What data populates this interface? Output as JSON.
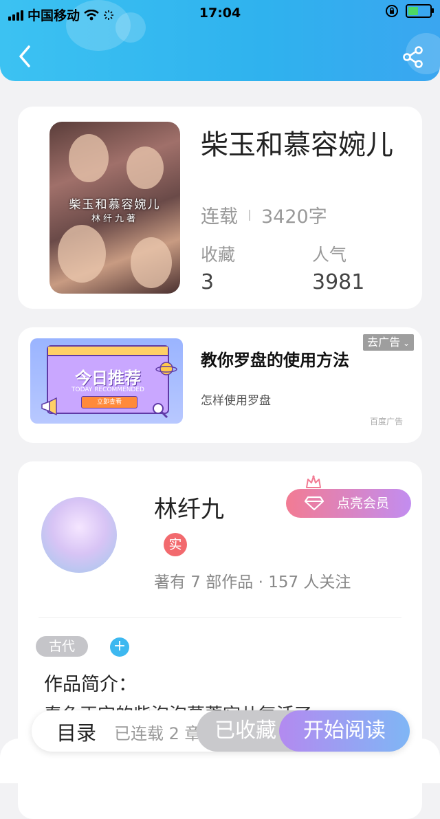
{
  "status_bar": {
    "carrier": "中国移动",
    "time": "17:04"
  },
  "book": {
    "title": "柴玉和慕容婉儿",
    "cover_title": "柴玉和慕容婉儿",
    "cover_author": "林纤九著",
    "status": "连载",
    "word_count": "3420字",
    "favorites_label": "收藏",
    "favorites_value": "3",
    "popularity_label": "人气",
    "popularity_value": "3981"
  },
  "ad": {
    "title": "教你罗盘的使用方法",
    "description": "怎样使用罗盘",
    "source": "百度广告",
    "tag": "去广告",
    "image_title": "今日推荐",
    "image_subtitle": "TODAY RECOMMENDED",
    "image_button": "立即查看"
  },
  "author": {
    "name": "林纤九",
    "vip_button": "点亮会员",
    "verified": "实",
    "works_info": "著有 7 部作品 · 157 人关注",
    "genre_tag": "古代",
    "add_tag": "+",
    "intro_label": "作品简介：",
    "intro_text": "春色正完的柴泡泡慕蓉宛儿复活了"
  },
  "bottom_bar": {
    "toc": "目录",
    "chapters": "已连载 2 章",
    "favorited": "已收藏",
    "start_reading": "开始阅读"
  },
  "colors": {
    "header_blue": "#2fb2ee",
    "vip_pink": "#f27b93",
    "vip_purple": "#c28df0",
    "verified_red": "#f26a6e",
    "accent_blue": "#3db8f0"
  }
}
